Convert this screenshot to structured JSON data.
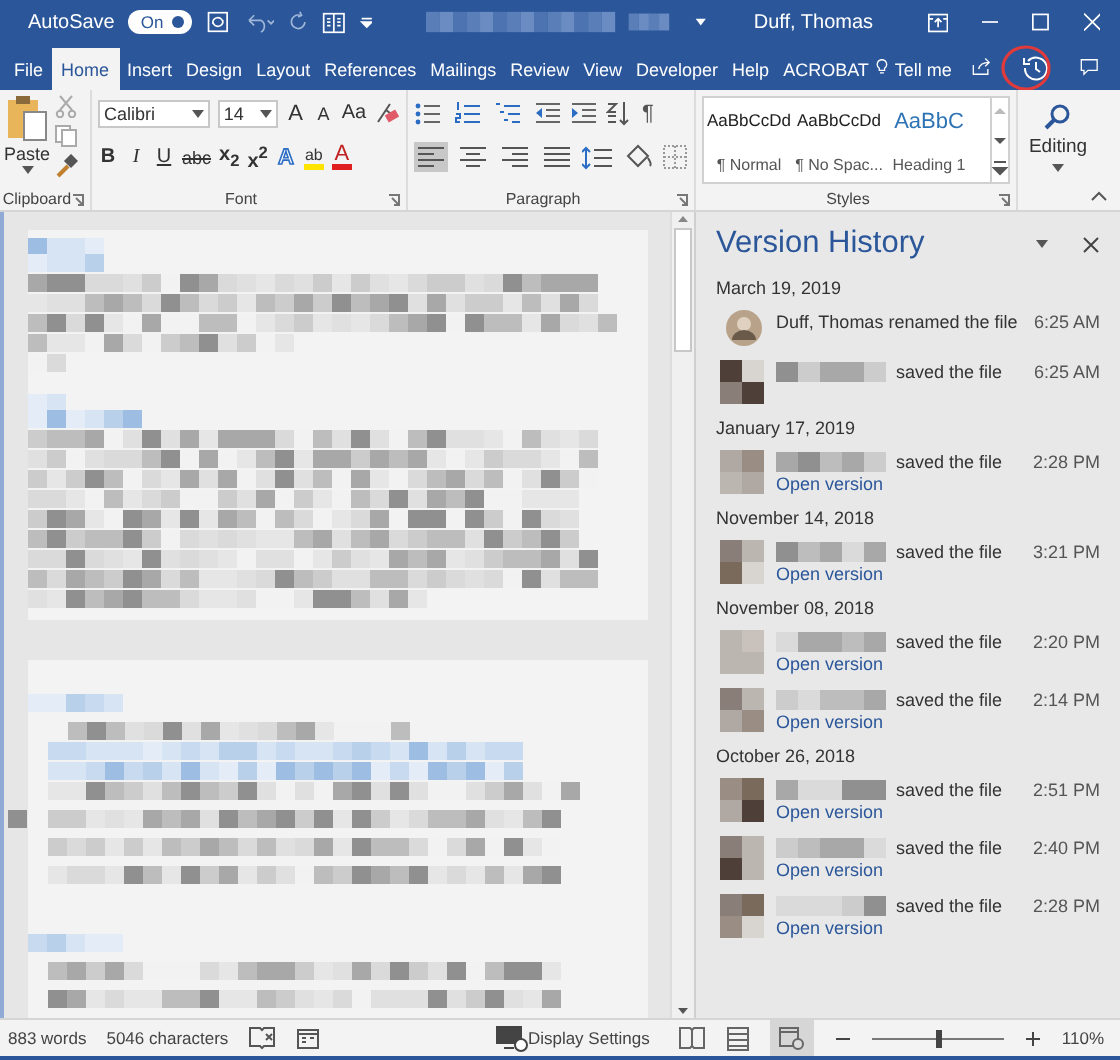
{
  "title_bar": {
    "autosave_label": "AutoSave",
    "autosave_toggle": {
      "label": "On",
      "on": true
    },
    "user": "Duff, Thomas"
  },
  "tabs": [
    {
      "label": "File",
      "selected": false
    },
    {
      "label": "Home",
      "selected": true
    },
    {
      "label": "Insert",
      "selected": false
    },
    {
      "label": "Design",
      "selected": false
    },
    {
      "label": "Layout",
      "selected": false
    },
    {
      "label": "References",
      "selected": false
    },
    {
      "label": "Mailings",
      "selected": false
    },
    {
      "label": "Review",
      "selected": false
    },
    {
      "label": "View",
      "selected": false
    },
    {
      "label": "Developer",
      "selected": false
    },
    {
      "label": "Help",
      "selected": false
    },
    {
      "label": "ACROBAT",
      "selected": false
    }
  ],
  "tell_me": "Tell me",
  "ribbon": {
    "paste": "Paste",
    "font_name": "Calibri",
    "font_size": "14",
    "font_tools": [
      {
        "kind": "grow",
        "glyph": "A"
      },
      {
        "kind": "shrink",
        "glyph": "A"
      },
      {
        "kind": "case",
        "glyph": "Aa"
      }
    ],
    "format_tools": [
      {
        "kind": "bold",
        "glyph": "B"
      },
      {
        "kind": "italic",
        "glyph": "I"
      },
      {
        "kind": "underline",
        "glyph": "U"
      },
      {
        "kind": "strike",
        "glyph": "abc"
      },
      {
        "kind": "sub",
        "glyph": "x$_{2}$"
      },
      {
        "kind": "sup",
        "glyph": "x$^{2}$"
      },
      {
        "kind": "effects",
        "glyph": "A"
      },
      {
        "kind": "highlight",
        "glyph": "ab"
      },
      {
        "kind": "color",
        "glyph": "A"
      }
    ],
    "pilcrow": "¶",
    "alignment": [
      {
        "kind": "left",
        "selected": true
      },
      {
        "kind": "center",
        "selected": false
      },
      {
        "kind": "right",
        "selected": false
      },
      {
        "kind": "justify",
        "selected": false
      }
    ],
    "styles": [
      {
        "preview": "AaBbCcDd",
        "name": "¶ Normal",
        "kind": "body"
      },
      {
        "preview": "AaBbCcDd",
        "name": "¶ No Spac...",
        "kind": "body"
      },
      {
        "preview": "AaBbC",
        "name": "Heading 1",
        "kind": "heading"
      }
    ],
    "editing": "Editing",
    "groups": [
      "Clipboard",
      "Font",
      "Paragraph",
      "Styles"
    ]
  },
  "version_history": {
    "title": "Version History",
    "days": [
      {
        "date": "March 19, 2019",
        "entries": [
          {
            "kind": "photo",
            "text": "Duff, Thomas renamed the file",
            "time": "6:25 AM"
          },
          {
            "kind": "mosaic",
            "text": "saved the file",
            "time": "6:25 AM"
          }
        ]
      },
      {
        "date": "January 17, 2019",
        "entries": [
          {
            "kind": "mosaic",
            "text": "saved the file",
            "time": "2:28 PM",
            "link": "Open version"
          }
        ]
      },
      {
        "date": "November 14, 2018",
        "entries": [
          {
            "kind": "mosaic",
            "text": "saved the file",
            "time": "3:21 PM",
            "link": "Open version"
          }
        ]
      },
      {
        "date": "November 08, 2018",
        "entries": [
          {
            "kind": "mosaic",
            "text": "saved the file",
            "time": "2:20 PM",
            "link": "Open version"
          },
          {
            "kind": "mosaic",
            "text": "saved the file",
            "time": "2:14 PM",
            "link": "Open version"
          }
        ]
      },
      {
        "date": "October 26, 2018",
        "entries": [
          {
            "kind": "mosaic",
            "text": "saved the file",
            "time": "2:51 PM",
            "link": "Open version"
          },
          {
            "kind": "mosaic",
            "text": "saved the file",
            "time": "2:40 PM",
            "link": "Open version"
          },
          {
            "kind": "mosaic",
            "text": "saved the file",
            "time": "2:28 PM",
            "link": "Open version"
          }
        ]
      }
    ]
  },
  "status_bar": {
    "words": "883 words",
    "characters": "5046 characters",
    "display_settings": "Display Settings",
    "zoom": "110%",
    "zoom_slider": {
      "level": 0.5
    }
  }
}
